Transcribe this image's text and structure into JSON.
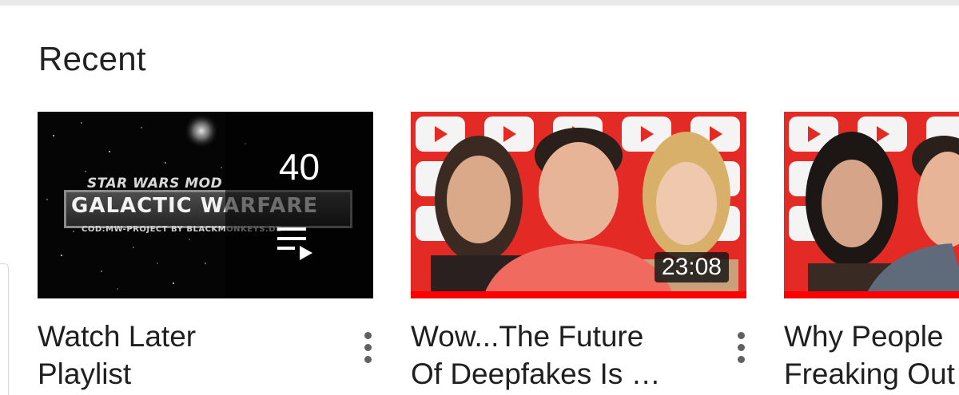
{
  "section": {
    "title": "Recent"
  },
  "cards": [
    {
      "title_line1": "Watch Later",
      "title_line2": "Playlist",
      "thumbnail": {
        "art_top": "STAR WARS MOD",
        "art_main": "GALACTIC WARFARE",
        "art_sub": "COD:MW-PROJECT BY BLACKMONKEYS.DE"
      },
      "video_count": "40",
      "icon": "playlist-play-icon",
      "menu_icon": "more-vert-icon"
    },
    {
      "title_line1": "Wow...The Future",
      "title_line2": "Of Deepfakes Is …",
      "duration": "23:08",
      "menu_icon": "more-vert-icon"
    },
    {
      "title_line1": "Why People",
      "title_line2": "Freaking Out"
    }
  ],
  "colors": {
    "accent_red": "#ff0000",
    "thumb_red": "#e42a25",
    "text": "#1f1f1f",
    "icon_gray": "#606060"
  }
}
